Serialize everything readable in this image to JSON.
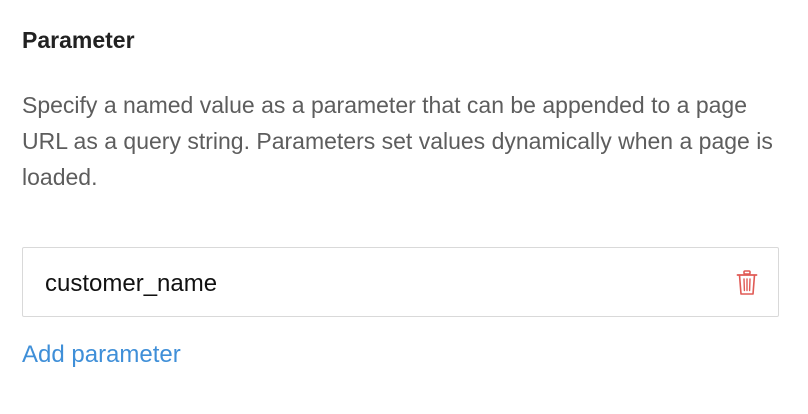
{
  "section": {
    "title": "Parameter",
    "description": "Specify a named value as a parameter that can be appended to a page URL as a query string. Parameters set values dynamically when a page is loaded."
  },
  "parameters": [
    {
      "name": "customer_name",
      "delete_icon": "trash-icon"
    }
  ],
  "actions": {
    "add_label": "Add parameter"
  },
  "colors": {
    "link": "#3f8fd8",
    "delete": "#e05a55",
    "border": "#d9d9d9"
  }
}
